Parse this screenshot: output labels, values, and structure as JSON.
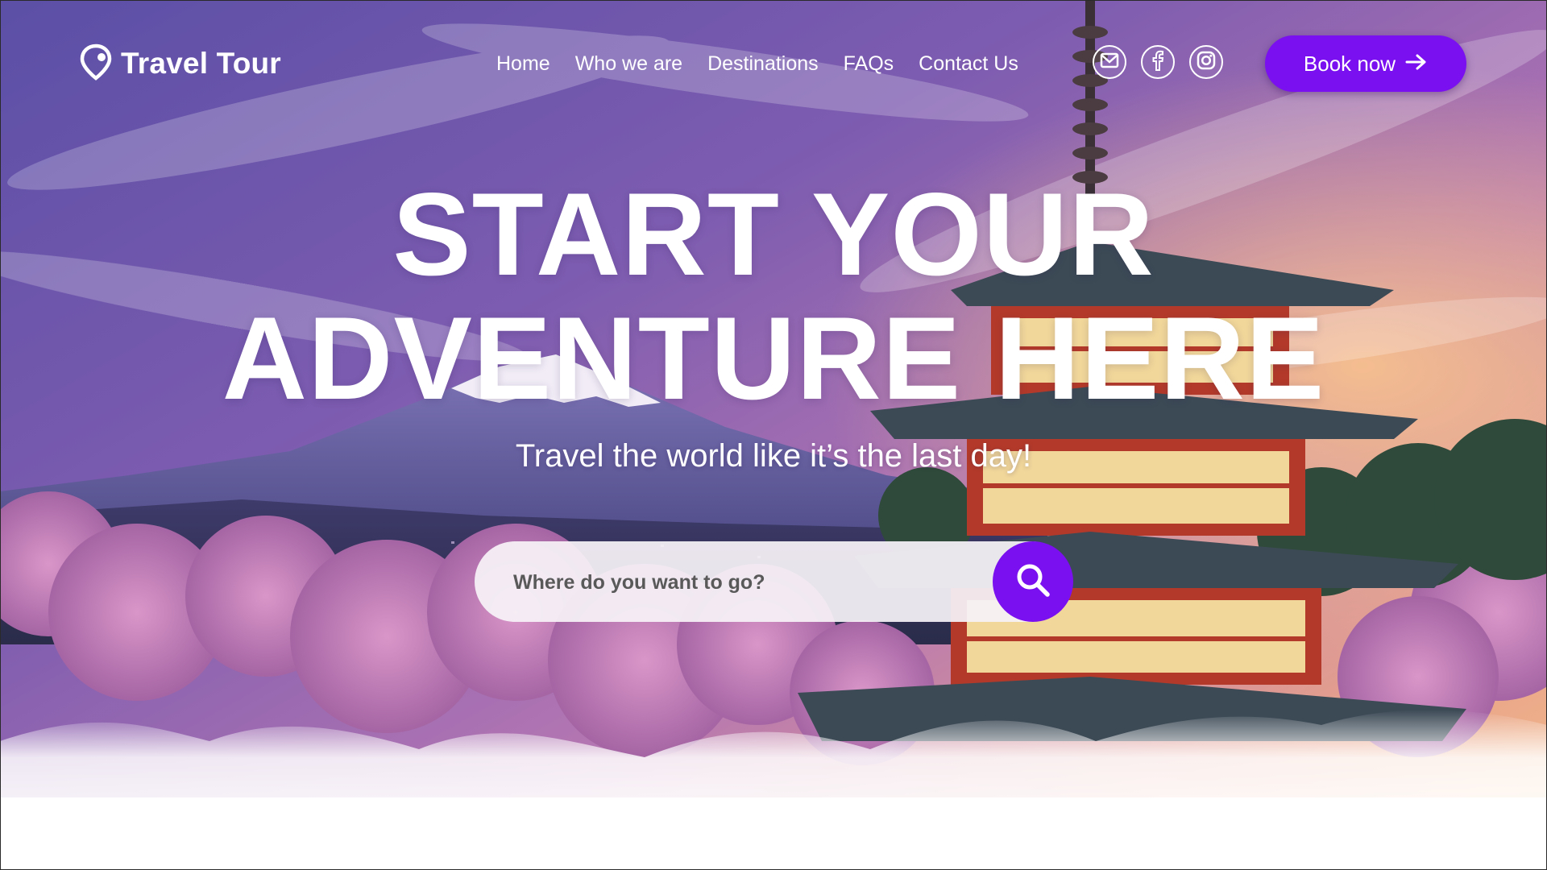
{
  "brand": {
    "name": "Travel Tour",
    "icon": "location-pin-icon"
  },
  "nav": {
    "items": [
      {
        "label": "Home"
      },
      {
        "label": "Who we are"
      },
      {
        "label": "Destinations"
      },
      {
        "label": "FAQs"
      },
      {
        "label": "Contact Us"
      }
    ]
  },
  "socials": [
    {
      "icon": "mail-icon"
    },
    {
      "icon": "facebook-icon"
    },
    {
      "icon": "instagram-icon"
    }
  ],
  "cta": {
    "label": "Book now",
    "icon": "arrow-right-icon"
  },
  "hero": {
    "title_line1": "START YOUR",
    "title_line2": "ADVENTURE HERE",
    "tagline": "Travel the world like it’s the last day!"
  },
  "search": {
    "placeholder": "Where do you want to go?",
    "value": "",
    "icon": "search-icon"
  },
  "colors": {
    "accent": "#7a10ef",
    "text": "#ffffff",
    "sky_top": "#5a4fa8",
    "sky_sunset": "#f2a878",
    "blossom": "#c07ab8"
  }
}
